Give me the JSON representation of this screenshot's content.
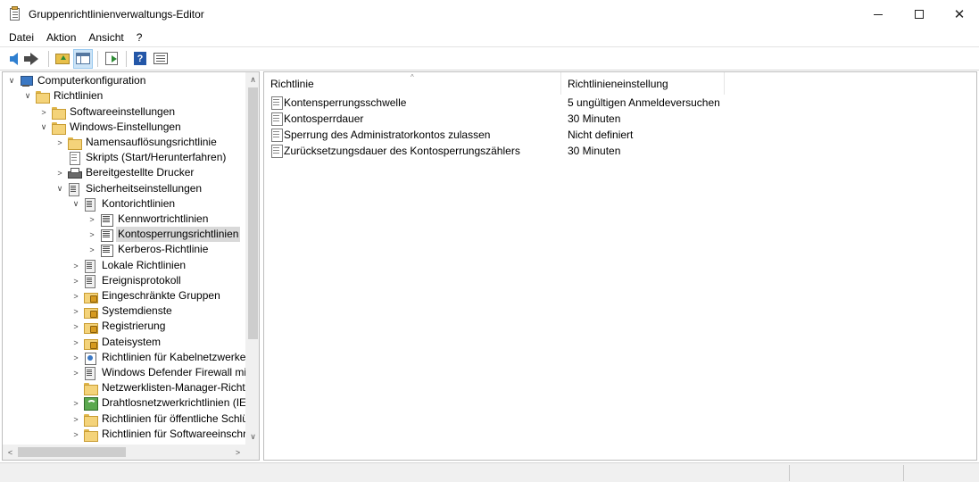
{
  "window": {
    "title": "Gruppenrichtlinienverwaltungs-Editor",
    "minimize": "",
    "maximize": "",
    "close": "✕"
  },
  "menu": [
    "Datei",
    "Aktion",
    "Ansicht",
    "?"
  ],
  "toolbar": [
    "back-icon",
    "forward-icon",
    "folder-up-icon",
    "show-hide-tree-icon",
    "export-list-icon",
    "help-icon",
    "properties-icon"
  ],
  "tree": {
    "nodes": [
      {
        "label": "Computerkonfiguration",
        "exp": "∨",
        "icon": "computer"
      },
      {
        "label": "Richtlinien",
        "exp": "∨",
        "icon": "folder"
      },
      {
        "label": "Softwareeinstellungen",
        "exp": ">",
        "icon": "folder"
      },
      {
        "label": "Windows-Einstellungen",
        "exp": "∨",
        "icon": "folder"
      },
      {
        "label": "Namensauflösungsrichtlinie",
        "exp": ">",
        "icon": "folder"
      },
      {
        "label": "Skripts (Start/Herunterfahren)",
        "exp": "",
        "icon": "doc"
      },
      {
        "label": "Bereitgestellte Drucker",
        "exp": ">",
        "icon": "printer"
      },
      {
        "label": "Sicherheitseinstellungen",
        "exp": "∨",
        "icon": "sec"
      },
      {
        "label": "Kontorichtlinien",
        "exp": "∨",
        "icon": "sec"
      },
      {
        "label": "Kennwortrichtlinien",
        "exp": ">",
        "icon": "sheet"
      },
      {
        "label": "Kontosperrungsrichtlinien",
        "exp": ">",
        "icon": "sheet"
      },
      {
        "label": "Kerberos-Richtlinie",
        "exp": ">",
        "icon": "sheet"
      },
      {
        "label": "Lokale Richtlinien",
        "exp": ">",
        "icon": "sec"
      },
      {
        "label": "Ereignisprotokoll",
        "exp": ">",
        "icon": "sec"
      },
      {
        "label": "Eingeschränkte Gruppen",
        "exp": ">",
        "icon": "lockfolder"
      },
      {
        "label": "Systemdienste",
        "exp": ">",
        "icon": "lockfolder"
      },
      {
        "label": "Registrierung",
        "exp": ">",
        "icon": "lockfolder"
      },
      {
        "label": "Dateisystem",
        "exp": ">",
        "icon": "lockfolder"
      },
      {
        "label": "Richtlinien für Kabelnetzwerke (",
        "exp": ">",
        "icon": "net"
      },
      {
        "label": "Windows Defender Firewall mit",
        "exp": ">",
        "icon": "sec"
      },
      {
        "label": "Netzwerklisten-Manager-Richtli",
        "exp": "",
        "icon": "folder"
      },
      {
        "label": "Drahtlosnetzwerkrichtlinien (IEE",
        "exp": ">",
        "icon": "wireless"
      },
      {
        "label": "Richtlinien für öffentliche Schlü",
        "exp": ">",
        "icon": "folder"
      },
      {
        "label": "Richtlinien für Softwareeinschrä",
        "exp": ">",
        "icon": "folder"
      }
    ],
    "scroll": {
      "up": "∧",
      "down": "∨",
      "left": "<",
      "right": ">"
    }
  },
  "list": {
    "columns": [
      "Richtlinie",
      "Richtlinieneinstellung"
    ],
    "sort_indicator": "^",
    "rows": [
      {
        "name": "Kontensperrungsschwelle",
        "value": "5 ungültigen Anmeldeversuchen"
      },
      {
        "name": "Kontosperrdauer",
        "value": "30 Minuten"
      },
      {
        "name": "Sperrung des Administratorkontos zulassen",
        "value": "Nicht definiert"
      },
      {
        "name": "Zurücksetzungsdauer des Kontosperrungszählers",
        "value": "30 Minuten"
      }
    ]
  }
}
